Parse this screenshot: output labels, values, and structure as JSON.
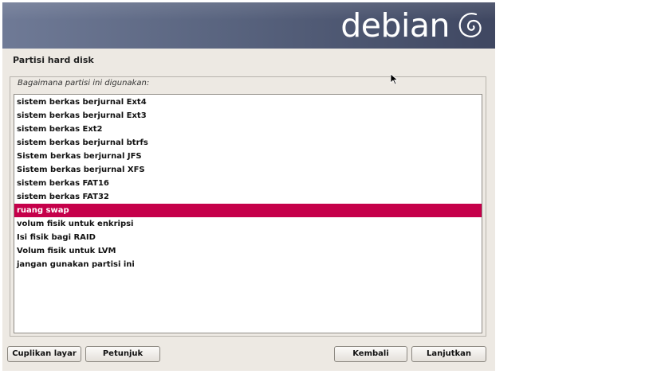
{
  "banner": {
    "logo_text": "debian",
    "logo_icon": "debian-swirl-icon"
  },
  "page": {
    "title": "Partisi hard disk",
    "question": "Bagaimana partisi ini digunakan:"
  },
  "list": {
    "items": [
      "sistem berkas berjurnal Ext4",
      "sistem berkas berjurnal Ext3",
      "sistem berkas Ext2",
      "sistem berkas berjurnal btrfs",
      "Sistem berkas berjurnal JFS",
      "Sistem berkas berjurnal XFS",
      "sistem berkas FAT16",
      "sistem berkas FAT32",
      "ruang swap",
      "volum fisik untuk enkripsi",
      "Isi fisik bagi RAID",
      "Volum fisik untuk LVM",
      "jangan gunakan partisi ini"
    ],
    "selected_index": 8
  },
  "buttons": {
    "screenshot": "Cuplikan layar",
    "help": "Petunjuk",
    "back": "Kembali",
    "continue": "Lanjutkan"
  },
  "colors": {
    "selection": "#c5004a",
    "banner_left": "#6f7a96",
    "banner_right": "#3f4761",
    "background": "#ede9e3"
  }
}
